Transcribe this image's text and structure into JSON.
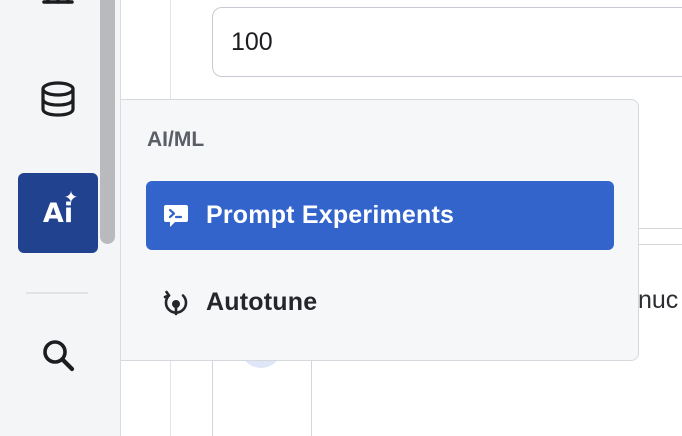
{
  "form": {
    "number_value": "100"
  },
  "background": {
    "partial_text": "nuc"
  },
  "rail": {
    "items": [
      {
        "icon": "chart-icon"
      },
      {
        "icon": "database-icon"
      },
      {
        "icon": "ai-sparkle-icon",
        "glyph": "Ai",
        "active": true
      },
      {
        "icon": "search-icon"
      }
    ]
  },
  "menu": {
    "title": "AI/ML",
    "items": [
      {
        "label": "Prompt Experiments",
        "icon": "prompt-terminal-icon",
        "selected": true
      },
      {
        "label": "Autotune",
        "icon": "autotune-icon",
        "selected": false
      }
    ]
  },
  "colors": {
    "accent": "#3264cc",
    "rail_active": "#20428f",
    "rail_bg": "#f4f5f7",
    "menu_bg": "#f6f7f9"
  }
}
